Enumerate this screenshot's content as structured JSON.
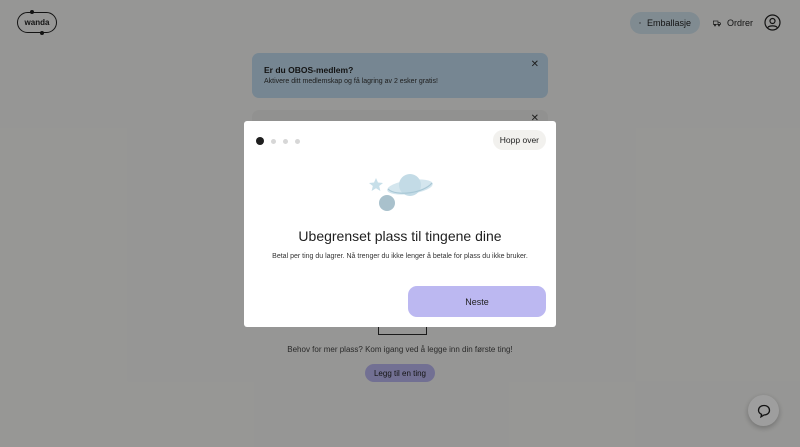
{
  "header": {
    "logo_text": "wanda",
    "packaging_label": "Emballasje",
    "orders_label": "Ordrer",
    "packaging_icon": "box-icon",
    "orders_icon": "truck-icon",
    "account_icon": "user-circle-icon"
  },
  "banner": {
    "title": "Er du OBOS-medlem?",
    "subtitle": "Aktivere ditt medlemskap og få lagring av 2 esker gratis!",
    "close": "✕"
  },
  "card2": {
    "close": "✕"
  },
  "empty_state": {
    "text": "Behov for mer plass? Kom igang ved å legge inn din første ting!",
    "add_label": "Legg til en ting"
  },
  "help": {
    "icon": "chat-bubble-icon"
  },
  "modal": {
    "steps_total": 4,
    "current_step": 1,
    "skip_label": "Hopp over",
    "title": "Ubegrenset plass til tingene dine",
    "body": "Betal per ting du lagrer. Nå trenger du ikke lenger å betale for plass du ikke bruker.",
    "next_label": "Neste",
    "illustration": "planet-illustration",
    "colors": {
      "primary_button": "#bcb8f1",
      "overlay": "rgba(0,0,0,0.38)",
      "banner": "#bed9ec"
    }
  }
}
